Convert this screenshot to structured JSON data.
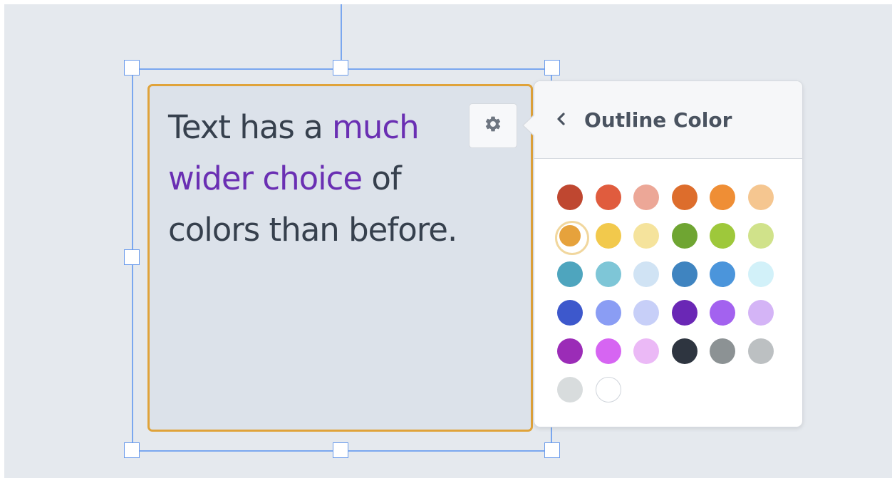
{
  "textbox": {
    "segments": [
      {
        "text": "Text has a ",
        "highlight": false
      },
      {
        "text": "much wider choice",
        "highlight": true
      },
      {
        "text": " of colors than before.",
        "highlight": false
      }
    ],
    "border_color": "#e0a33a",
    "text_color": "#36404d",
    "highlight_color": "#6a2fb3"
  },
  "gear_button": {
    "icon": "gear-icon"
  },
  "popover": {
    "back_icon": "chevron-left-icon",
    "title": "Outline Color",
    "selected_color": "#e6a23c",
    "swatches": [
      "#bf4730",
      "#e05c3e",
      "#eca797",
      "#dd6d2c",
      "#ef8e35",
      "#f5c690",
      "#e6a23c",
      "#f2c94c",
      "#f5e39c",
      "#6fa532",
      "#9ec83b",
      "#d0e28a",
      "#4ea5be",
      "#7ec6d7",
      "#d0e3f4",
      "#3f84c0",
      "#4b95db",
      "#d2f1f9",
      "#3d58cc",
      "#8a9df4",
      "#c7cff8",
      "#6a27b5",
      "#a362ef",
      "#d4b4f6",
      "#9b2cb7",
      "#d665f2",
      "#ebb9f6",
      "#2e3540",
      "#8c9294",
      "#bcc0c2",
      "#d8dcdd",
      "#ffffff"
    ]
  }
}
